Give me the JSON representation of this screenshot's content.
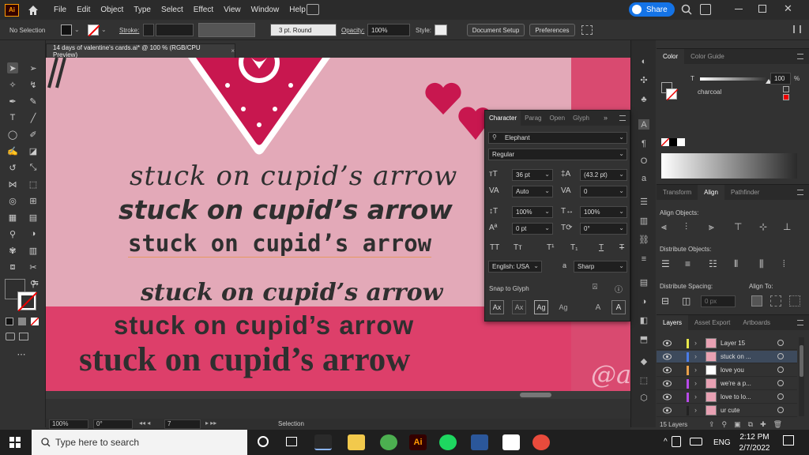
{
  "app": {
    "logo": "Ai",
    "icons": {
      "home": "home-icon",
      "share": "share-icon",
      "search": "search-icon"
    }
  },
  "menu": [
    "File",
    "Edit",
    "Object",
    "Type",
    "Select",
    "Effect",
    "View",
    "Window",
    "Help"
  ],
  "share_label": "Share",
  "control_bar": {
    "selection": "No Selection",
    "stroke_label": "Stroke:",
    "brush": "3 pt. Round",
    "opacity_label": "Opacity:",
    "opacity_value": "100%",
    "style_label": "Style:",
    "document_setup": "Document Setup",
    "preferences": "Preferences"
  },
  "document_tab": {
    "title": "14 days of valentine's cards.ai* @ 100 % (RGB/CPU Preview)",
    "close": "×"
  },
  "artboard": {
    "lines": [
      "stuck on cupid’s arrow",
      "stuck on cupid’s arrow",
      "stuck on cupid’s arrow",
      "stuck on cupid’s arrow",
      "stuck on cupid’s arrow",
      "stuck on cupid’s arrow"
    ],
    "partial_text": "@a"
  },
  "status_bar": {
    "zoom": "100%",
    "rotate": "0°",
    "artboard_num": "7",
    "tool": "Selection"
  },
  "character_panel": {
    "tabs": [
      "Character",
      "Parag",
      "Open",
      "Glyph"
    ],
    "font_family": "Elephant",
    "font_style": "Regular",
    "font_size": "36 pt",
    "leading": "(43.2 pt)",
    "kerning": "Auto",
    "tracking": "0",
    "v_scale": "100%",
    "h_scale": "100%",
    "baseline": "0 pt",
    "rotation": "0°",
    "language": "English: USA",
    "aa_label": "a",
    "antialias": "Sharp",
    "snap_label": "Snap to Glyph",
    "type_buttons": [
      "TT",
      "Tт",
      "T¹",
      "T₁",
      "T",
      "T"
    ]
  },
  "color_panel": {
    "tabs": [
      "Color",
      "Color Guide"
    ],
    "t_label": "T",
    "tint": "100",
    "pct": "%",
    "swatch_name": "charcoal"
  },
  "align_panel": {
    "tabs": [
      "Transform",
      "Align",
      "Pathfinder"
    ],
    "align_objects": "Align Objects:",
    "distribute_objects": "Distribute Objects:",
    "distribute_spacing": "Distribute Spacing:",
    "align_to": "Align To:",
    "spacing_value": "0 px"
  },
  "layers_panel": {
    "tabs": [
      "Layers",
      "Asset Export",
      "Artboards"
    ],
    "rows": [
      {
        "name": "Layer 15",
        "color": "#e8e84a"
      },
      {
        "name": "stuck on ...",
        "color": "#4a7ce8"
      },
      {
        "name": "love you",
        "color": "#e8a04a"
      },
      {
        "name": "we're a p...",
        "color": "#b84ae8"
      },
      {
        "name": "love to lo...",
        "color": "#b84ae8"
      },
      {
        "name": "ur cute",
        "color": "#222222"
      }
    ],
    "count": "15 Layers"
  },
  "taskbar": {
    "search_placeholder": "Type here to search",
    "language": "ENG",
    "time": "2:12 PM",
    "date": "2/7/2022"
  },
  "colors": {
    "artboard_pink": "#e3a9b8",
    "artboard_magenta": "#dd3f6a",
    "heart": "#c8174f",
    "text": "#2f2f2f"
  }
}
